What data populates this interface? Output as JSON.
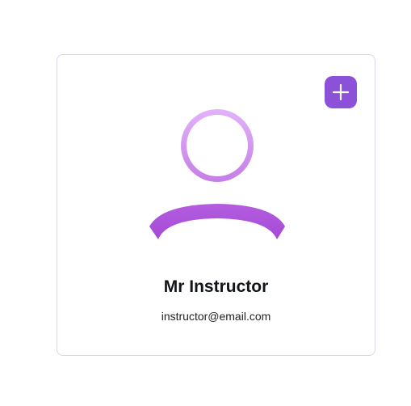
{
  "profile_card": {
    "name": "Mr Instructor",
    "email": "instructor@email.com",
    "avatar_icon": "user-icon",
    "add_icon": "plus-icon"
  },
  "colors": {
    "accent": "#8b52d9",
    "avatar_light": "#e2b2fb",
    "avatar_dark": "#a952d8",
    "card_border": "#d8d6ec"
  }
}
